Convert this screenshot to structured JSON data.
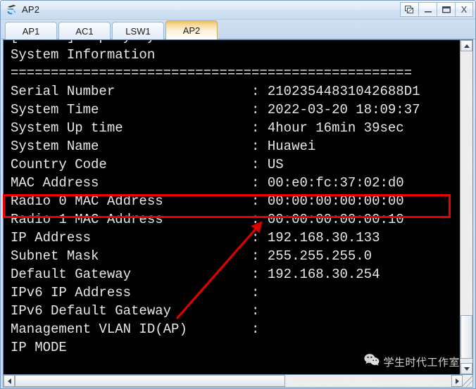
{
  "window": {
    "title": "AP2",
    "icon": "enspdevice-icon",
    "buttons": [
      {
        "name": "restore-windows-button",
        "icon": "cascade-windows-icon",
        "label": ""
      },
      {
        "name": "minimize-button",
        "icon": "minimize-icon",
        "label": ""
      },
      {
        "name": "maximize-button",
        "icon": "maximize-icon",
        "label": ""
      },
      {
        "name": "close-button",
        "icon": "close-icon",
        "label": "X"
      }
    ]
  },
  "tabs": [
    {
      "label": "AP1",
      "active": false
    },
    {
      "label": "AC1",
      "active": false
    },
    {
      "label": "LSW1",
      "active": false
    },
    {
      "label": "AP2",
      "active": true
    }
  ],
  "terminal": {
    "partial_top_line": "==================================",
    "content": "[Huawei]display system-information\nSystem Information\n==================================================\nSerial Number                 : 21023544831042688D1\nSystem Time                   : 2022-03-20 18:09:37\nSystem Up time                : 4hour 16min 39sec\nSystem Name                   : Huawei\nCountry Code                  : US\nMAC Address                   : 00:e0:fc:37:02:d0\nRadio 0 MAC Address           : 00:00:00:00:00:00\nRadio 1 MAC Address           : 00:00:00:00:00:10\nIP Address                    : 192.168.30.133\nSubnet Mask                   : 255.255.255.0\nDefault Gateway               : 192.168.30.254\nIPv6 IP Address               :\nIPv6 Default Gateway          :\nManagement VLAN ID(AP)        :\nIP MODE",
    "fields": [
      {
        "label": "Serial Number",
        "value": "21023544831042688D1"
      },
      {
        "label": "System Time",
        "value": "2022-03-20 18:09:37"
      },
      {
        "label": "System Up time",
        "value": "4hour 16min 39sec"
      },
      {
        "label": "System Name",
        "value": "Huawei"
      },
      {
        "label": "Country Code",
        "value": "US"
      },
      {
        "label": "MAC Address",
        "value": "00:e0:fc:37:02:d0"
      },
      {
        "label": "Radio 0 MAC Address",
        "value": "00:00:00:00:00:00"
      },
      {
        "label": "Radio 1 MAC Address",
        "value": "00:00:00:00:00:10"
      },
      {
        "label": "IP Address",
        "value": "192.168.30.133"
      },
      {
        "label": "Subnet Mask",
        "value": "255.255.255.0"
      },
      {
        "label": "Default Gateway",
        "value": "192.168.30.254"
      },
      {
        "label": "IPv6 IP Address",
        "value": ""
      },
      {
        "label": "IPv6 Default Gateway",
        "value": ""
      },
      {
        "label": "Management VLAN ID(AP)",
        "value": ""
      },
      {
        "label": "IP MODE",
        "value": ""
      }
    ],
    "command": "[Huawei]display system-information",
    "heading": "System Information"
  },
  "annotations": {
    "highlight_color": "#ee0000",
    "highlight_target": "MAC Address",
    "arrow_color": "#dd0000",
    "arrow_points_to": "MAC Address value"
  },
  "watermark": {
    "text": "学生时代工作室",
    "icon": "wechat-icon"
  },
  "scrollbars": {
    "vertical_up": "▲",
    "vertical_down": "▼",
    "horizontal_left": "◄",
    "horizontal_right": "►"
  }
}
